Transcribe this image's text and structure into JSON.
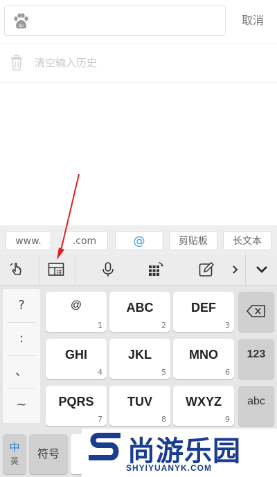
{
  "search": {
    "placeholder": "",
    "cancel_label": "取消"
  },
  "history": {
    "clear_label": "清空输入历史"
  },
  "keyboard": {
    "quick_row": [
      "www.",
      ".com",
      "@",
      "剪贴板",
      "长文本"
    ],
    "tool_icons": [
      "cursor-hand-icon",
      "layout-pinyin-icon",
      "microphone-icon",
      "keypad-icon",
      "edit-icon",
      "chevron-right-icon",
      "chevron-down-icon"
    ],
    "layout_icon_text": "拼",
    "side_keys": [
      "?",
      ":",
      "、",
      "~"
    ],
    "keys": [
      {
        "label": "@",
        "num": "1"
      },
      {
        "label": "ABC",
        "num": "2"
      },
      {
        "label": "DEF",
        "num": "3"
      },
      {
        "label": "GHI",
        "num": "4"
      },
      {
        "label": "JKL",
        "num": "5"
      },
      {
        "label": "MNO",
        "num": "6"
      },
      {
        "label": "PQRS",
        "num": "7"
      },
      {
        "label": "TUV",
        "num": "8"
      },
      {
        "label": "WXYZ",
        "num": "9"
      }
    ],
    "right_keys": [
      "123",
      "abc"
    ],
    "lang_top": "中",
    "lang_bottom": "英",
    "symbols_label": "符号"
  },
  "watermark": {
    "cn": "尚游乐园",
    "en": "SHYIYUANYK.COM"
  },
  "colors": {
    "accent": "#3aa0e0",
    "arrow": "#e02020",
    "watermark": "#1a3d8f"
  }
}
